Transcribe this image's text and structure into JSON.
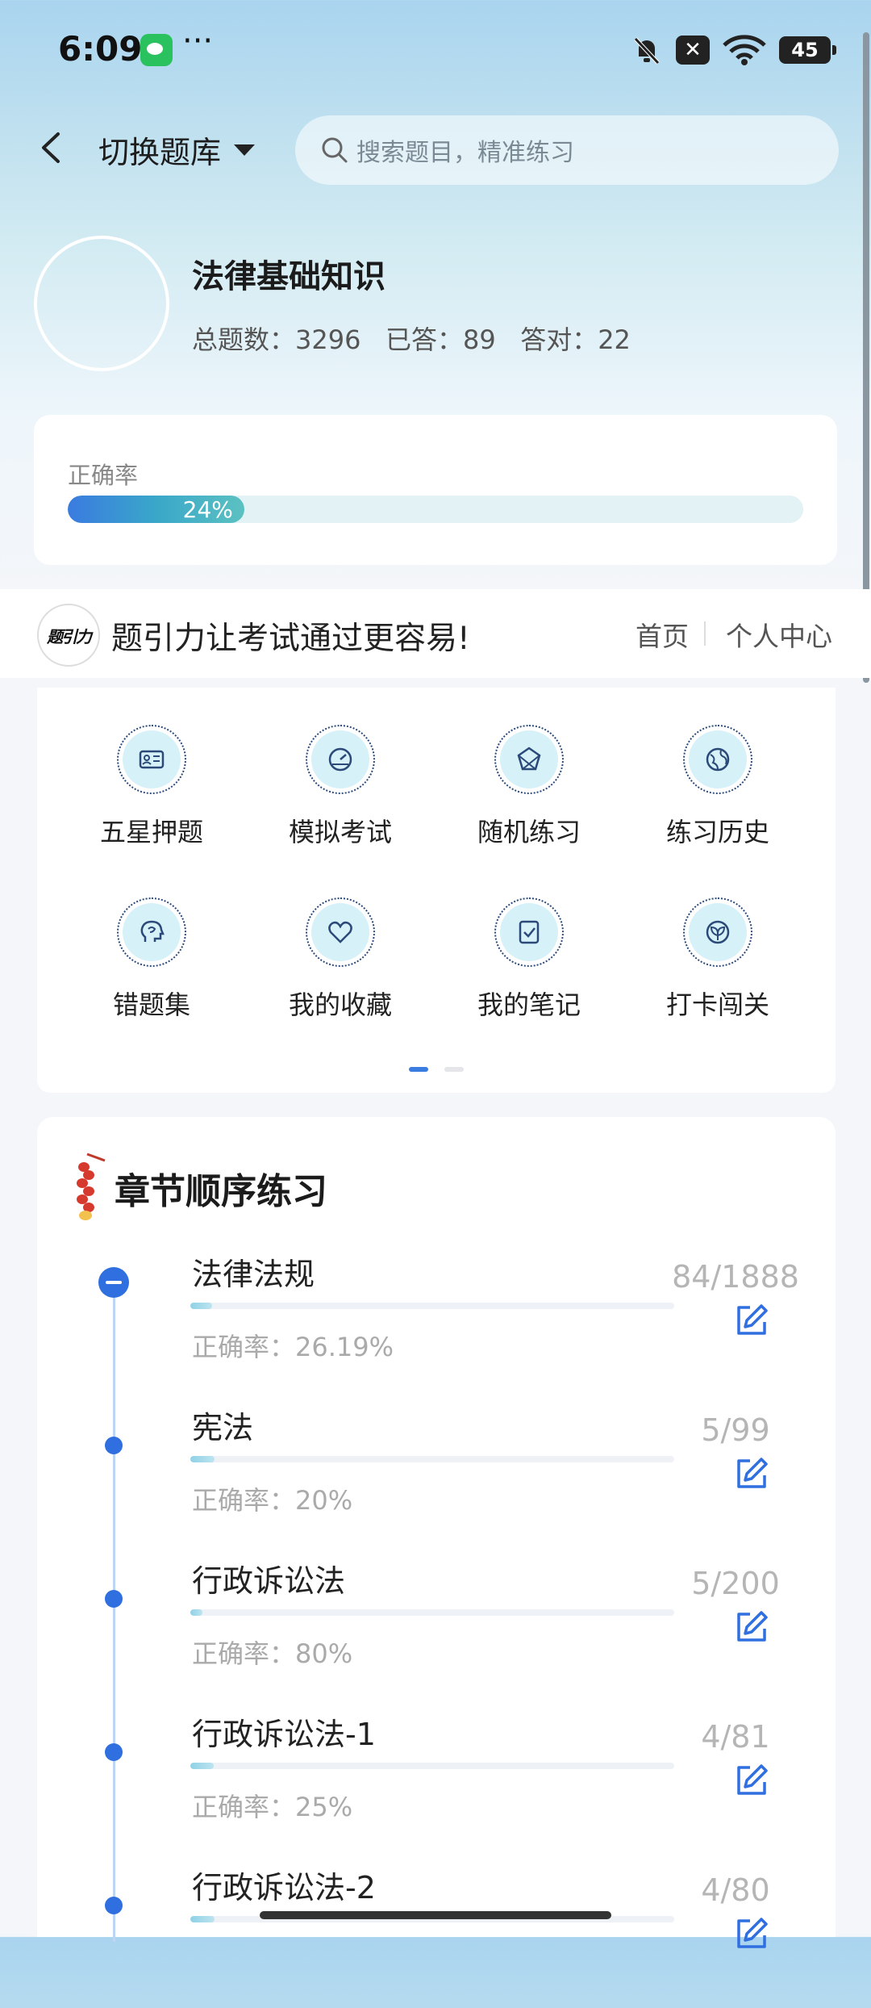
{
  "status_bar": {
    "time": "6:09",
    "more": "···",
    "battery": "45"
  },
  "header": {
    "switch_label": "切换题库",
    "search_placeholder": "搜索题目，精准练习"
  },
  "bank": {
    "title": "法律基础知识",
    "stats": "总题数：3296   已答：89   答对：22"
  },
  "accuracy": {
    "label": "正确率",
    "percent": 24,
    "percent_text": "24%"
  },
  "banner": {
    "logo_text": "题引力",
    "slogan": "题引力让考试通过更容易!",
    "nav_home": "首页",
    "nav_me": "个人中心"
  },
  "functions": [
    {
      "label": "五星押题",
      "icon": "id-card-icon"
    },
    {
      "label": "模拟考试",
      "icon": "speedometer-icon"
    },
    {
      "label": "随机练习",
      "icon": "shuffle-icon"
    },
    {
      "label": "练习历史",
      "icon": "globe-icon"
    },
    {
      "label": "错题集",
      "icon": "head-icon"
    },
    {
      "label": "我的收藏",
      "icon": "heart-icon"
    },
    {
      "label": "我的笔记",
      "icon": "note-check-icon"
    },
    {
      "label": "打卡闯关",
      "icon": "leaf-icon"
    }
  ],
  "pager": {
    "total": 2,
    "active": 0
  },
  "chapters": {
    "title": "章节顺序练习",
    "items": [
      {
        "name": "法律法规",
        "accuracy": "正确率：26.19%",
        "count": "84/1888",
        "progress": 0.0445
      },
      {
        "name": "宪法",
        "accuracy": "正确率：20%",
        "count": "5/99",
        "progress": 0.0505
      },
      {
        "name": "行政诉讼法",
        "accuracy": "正确率：80%",
        "count": "5/200",
        "progress": 0.025
      },
      {
        "name": "行政诉讼法-1",
        "accuracy": "正确率：25%",
        "count": "4/81",
        "progress": 0.049
      },
      {
        "name": "行政诉讼法-2",
        "accuracy": "",
        "count": "4/80",
        "progress": 0.05
      }
    ]
  },
  "colors": {
    "accent": "#2f6fe0",
    "icon_bg": "#d6f1f7",
    "icon_stroke": "#2b4a7a"
  }
}
